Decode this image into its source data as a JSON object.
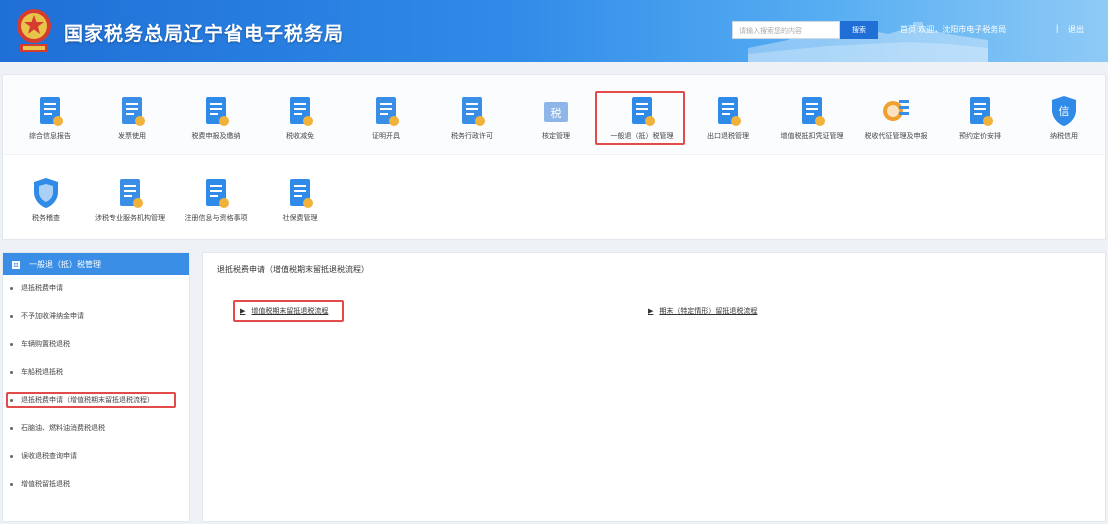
{
  "header": {
    "site_title": "国家税务总局辽宁省电子税务局",
    "search_placeholder": "请输入搜索您的内容",
    "search_button": "搜索",
    "top_links": "首页    欢迎，沈阳市电子税务局",
    "separator": "|",
    "logout": "退出"
  },
  "tiles": [
    {
      "label": "综合信息报告",
      "icon": "report-icon",
      "color": "#2f8ae8"
    },
    {
      "label": "发票使用",
      "icon": "invoice-icon",
      "color": "#3a8ee6"
    },
    {
      "label": "税费申报及缴纳",
      "icon": "payment-icon",
      "color": "#2f8ae8"
    },
    {
      "label": "税收减免",
      "icon": "tax-relief-icon",
      "color": "#2f8ae8"
    },
    {
      "label": "证明开具",
      "icon": "certificate-icon",
      "color": "#3a8ee6"
    },
    {
      "label": "税务行政许可",
      "icon": "permit-icon",
      "color": "#3a8ee6"
    },
    {
      "label": "核定管理",
      "icon": "tax-assess-icon",
      "color": "#3a8ee6"
    },
    {
      "label": "一般退（抵）税管理",
      "icon": "refund-icon",
      "color": "#2f8ae8"
    },
    {
      "label": "出口退税管理",
      "icon": "export-refund-icon",
      "color": "#2f8ae8"
    },
    {
      "label": "增值税抵扣凭证管理",
      "icon": "vat-deduction-icon",
      "color": "#2f8ae8"
    },
    {
      "label": "税收代征管理及申报",
      "icon": "collection-icon",
      "color": "#f0a030"
    },
    {
      "label": "预约定价安排",
      "icon": "pricing-icon",
      "color": "#2f8ae8"
    },
    {
      "label": "纳税信用",
      "icon": "credit-icon",
      "color": "#2f8ae8"
    },
    {
      "label": "税务稽查",
      "icon": "shield-icon",
      "color": "#2f8ae8"
    },
    {
      "label": "涉税专业服务机构管理",
      "icon": "agency-icon",
      "color": "#3a8ee6"
    },
    {
      "label": "注册信息与资格事项",
      "icon": "registration-icon",
      "color": "#2f8ae8"
    },
    {
      "label": "社保费管理",
      "icon": "social-insurance-icon",
      "color": "#2f8ae8"
    }
  ],
  "sidebar": {
    "title": "一般退（抵）税管理",
    "items": [
      {
        "label": "退抵税费申请"
      },
      {
        "label": "不予加收滞纳金申请"
      },
      {
        "label": "车辆购置税退税"
      },
      {
        "label": "车船税退抵税"
      },
      {
        "label": "退抵税费申请（增值税期末留抵退税流程）"
      },
      {
        "label": "石脑油、燃料油消费税退税"
      },
      {
        "label": "误收退税查询申请"
      },
      {
        "label": "增值税留抵退税"
      }
    ]
  },
  "main": {
    "title": "退抵税费申请（增值税期末留抵退税流程）",
    "links": [
      {
        "label": "增值税期末留抵退税流程"
      },
      {
        "label": "期末（特定情形）留抵退税流程"
      }
    ]
  },
  "accent_color": "#2f8ae8",
  "highlight_color": "#e34b4b"
}
